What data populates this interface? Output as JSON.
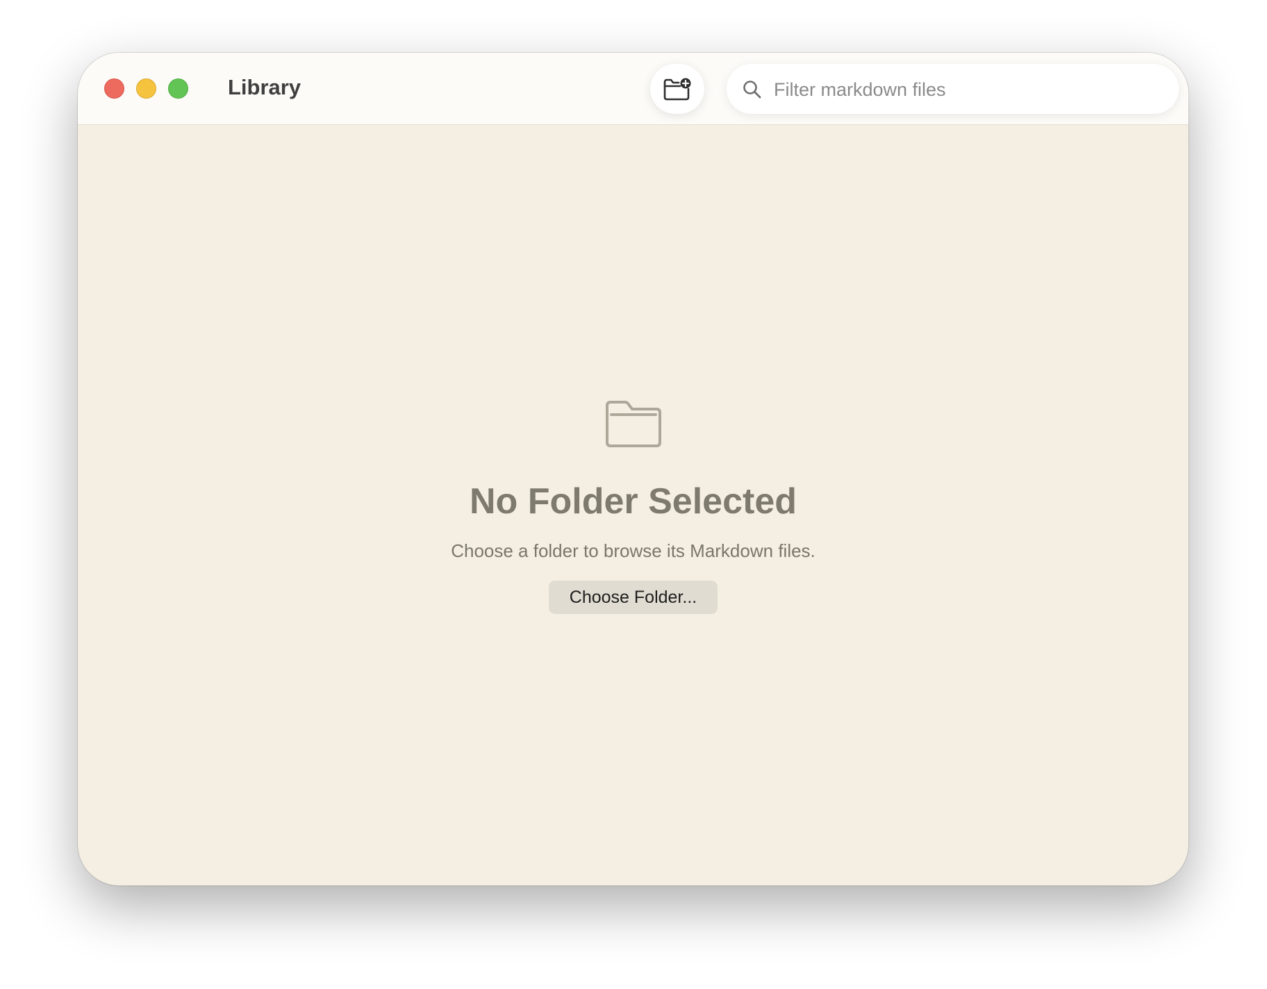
{
  "window": {
    "title": "Library"
  },
  "toolbar": {
    "add_folder_icon": "folder-badge-plus-icon"
  },
  "search": {
    "placeholder": "Filter markdown files",
    "value": "",
    "icon": "magnifying-glass-icon"
  },
  "empty_state": {
    "icon": "folder-icon",
    "title": "No Folder Selected",
    "subtitle": "Choose a folder to browse its Markdown files.",
    "button_label": "Choose Folder..."
  },
  "colors": {
    "close": "#ed6a5e",
    "minimize": "#f5c33e",
    "zoom": "#61c454",
    "content_background": "#f4efe2",
    "titlebar_background": "#fcfbf8"
  }
}
